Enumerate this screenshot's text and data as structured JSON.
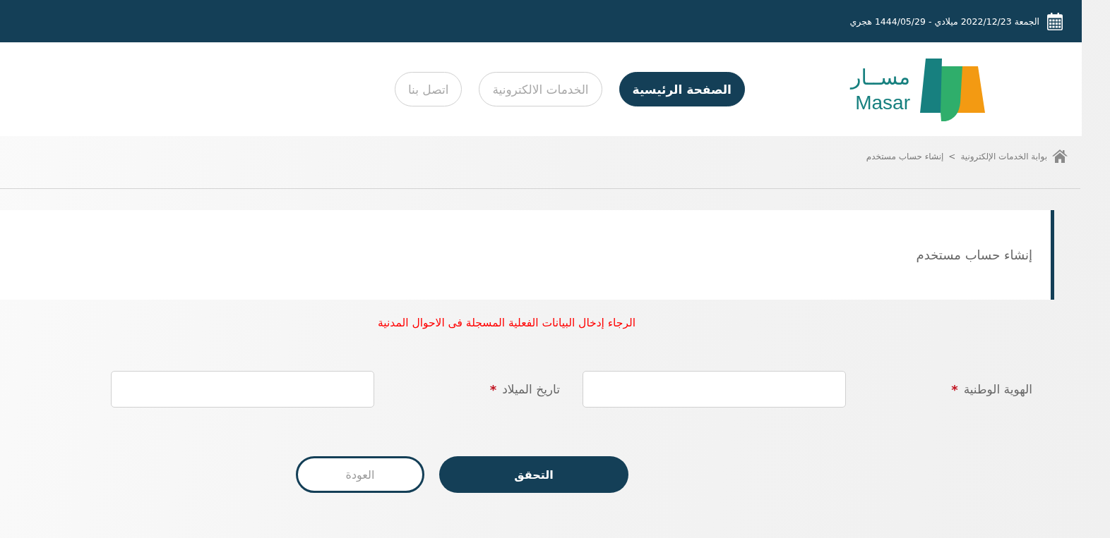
{
  "top_bar": {
    "date": "الجمعة 2022/12/23 ميلادي - 1444/05/29 هجري"
  },
  "header": {
    "logo": {
      "arabic": "مســار",
      "latin": "Masar"
    },
    "nav": [
      {
        "label": "الصفحة الرئيسية",
        "selected": true
      },
      {
        "label": "الخدمات الالكترونية",
        "selected": false
      },
      {
        "label": "اتصل بنا",
        "selected": false
      }
    ]
  },
  "breadcrumb": {
    "items": [
      "بوابة الخدمات الإلكترونية",
      "إنشاء حساب مستخدم"
    ],
    "separator": ">"
  },
  "page_title": "إنشاء حساب مستخدم",
  "notice": "الرجاء إدخال البيانات الفعلية المسجلة فى الاحوال المدنية",
  "form": {
    "fields": [
      {
        "label": "الهوية الوطنية",
        "required_mark": "*"
      },
      {
        "label": "تاريخ الميلاد",
        "required_mark": "*"
      }
    ]
  },
  "buttons": [
    {
      "label": "التحقق",
      "kind": "primary"
    },
    {
      "label": "العودة",
      "kind": "secondary"
    }
  ]
}
